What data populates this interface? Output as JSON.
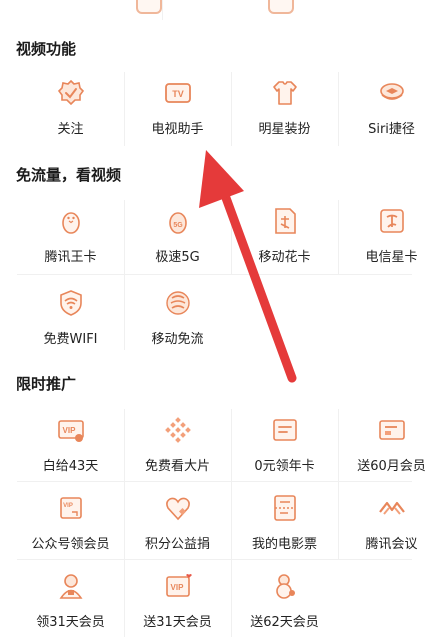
{
  "sections": [
    {
      "title": "视频功能",
      "items": [
        {
          "label": "关注",
          "icon": "check-badge-icon"
        },
        {
          "label": "电视助手",
          "icon": "tv-icon"
        },
        {
          "label": "明星装扮",
          "icon": "shirt-icon"
        },
        {
          "label": "Siri捷径",
          "icon": "layers-icon"
        }
      ]
    },
    {
      "title": "免流量，看视频",
      "items": [
        {
          "label": "腾讯王卡",
          "icon": "penguin-card-icon"
        },
        {
          "label": "极速5G",
          "icon": "penguin-5g-icon"
        },
        {
          "label": "移动花卡",
          "icon": "flower-card-icon"
        },
        {
          "label": "电信星卡",
          "icon": "telecom-card-icon"
        },
        {
          "label": "免费WIFI",
          "icon": "wifi-shield-icon"
        },
        {
          "label": "移动免流",
          "icon": "mobile-logo-icon"
        }
      ]
    },
    {
      "title": "限时推广",
      "items": [
        {
          "label": "白给43天",
          "icon": "vip-card-icon"
        },
        {
          "label": "免费看大片",
          "icon": "diamond-grid-icon"
        },
        {
          "label": "0元领年卡",
          "icon": "card-icon"
        },
        {
          "label": "送60月会员",
          "icon": "ticket-card-icon"
        },
        {
          "label": "公众号领会员",
          "icon": "vip-membership-icon"
        },
        {
          "label": "积分公益捐",
          "icon": "heart-icon"
        },
        {
          "label": "我的电影票",
          "icon": "film-ticket-icon"
        },
        {
          "label": "腾讯会议",
          "icon": "meeting-logo-icon"
        },
        {
          "label": "领31天会员",
          "icon": "gift-person-icon"
        },
        {
          "label": "送31天会员",
          "icon": "vip-heart-icon"
        },
        {
          "label": "送62天会员",
          "icon": "gourd-icon"
        }
      ]
    }
  ],
  "colors": {
    "accent": "#e8865a",
    "arrow": "#e53a3a"
  }
}
